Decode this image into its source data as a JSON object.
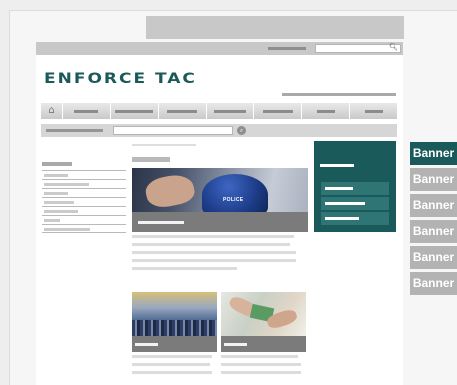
{
  "logo": {
    "text": "ENFORCE TAC"
  },
  "hero": {
    "image_label": "POLICE"
  },
  "icons": {
    "search": "search-icon",
    "home": "home-icon",
    "search_button": "search-icon"
  },
  "banners": [
    "Banner",
    "Banner",
    "Banner",
    "Banner",
    "Banner",
    "Banner"
  ],
  "colors": {
    "brand": "#1b5a5a",
    "brand_light": "#2f7575",
    "banner_inactive": "#b3b3b3",
    "placeholder_bar": "#c8c8c8"
  }
}
